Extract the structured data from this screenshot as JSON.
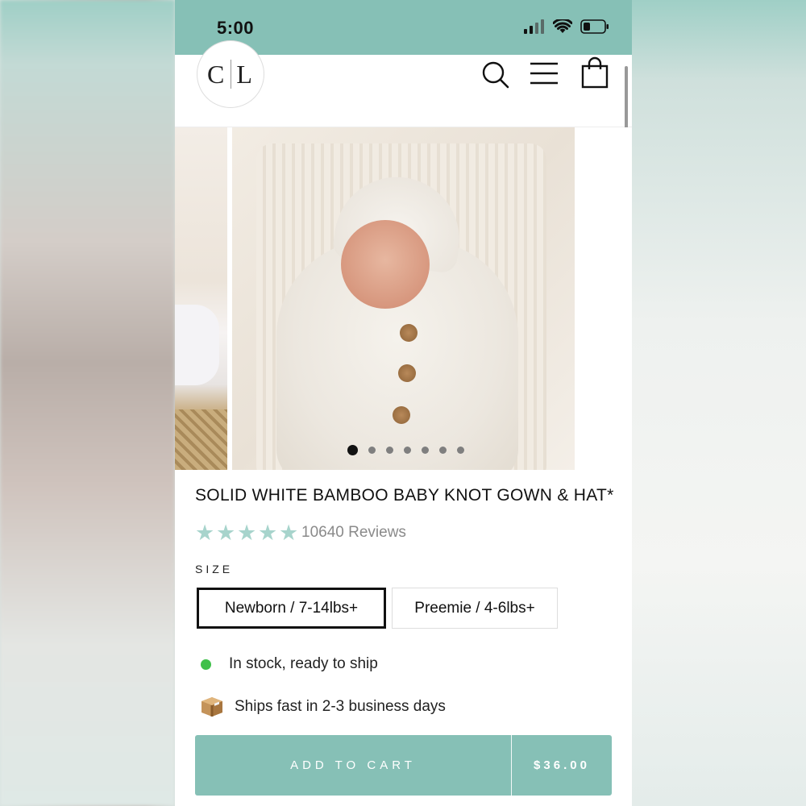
{
  "status_bar": {
    "time": "5:00"
  },
  "header": {
    "logo_left": "C",
    "logo_right": "L"
  },
  "carousel": {
    "slide_count": 7,
    "active_index": 0
  },
  "product": {
    "title": "SOLID WHITE BAMBOO BABY KNOT GOWN & HAT*",
    "rating": 5,
    "reviews_text": "10640 Reviews",
    "size_label": "SIZE",
    "sizes": [
      {
        "label": "Newborn / 7-14lbs+",
        "selected": true
      },
      {
        "label": "Preemie / 4-6lbs+",
        "selected": false
      }
    ],
    "stock_text": "In stock, ready to ship",
    "shipping_text": "Ships fast in 2-3 business days"
  },
  "cart": {
    "label": "ADD TO CART",
    "price": "$36.00"
  },
  "colors": {
    "brand_teal": "#86c0b6",
    "star": "#a7d4cc",
    "in_stock_green": "#3fc04a"
  }
}
